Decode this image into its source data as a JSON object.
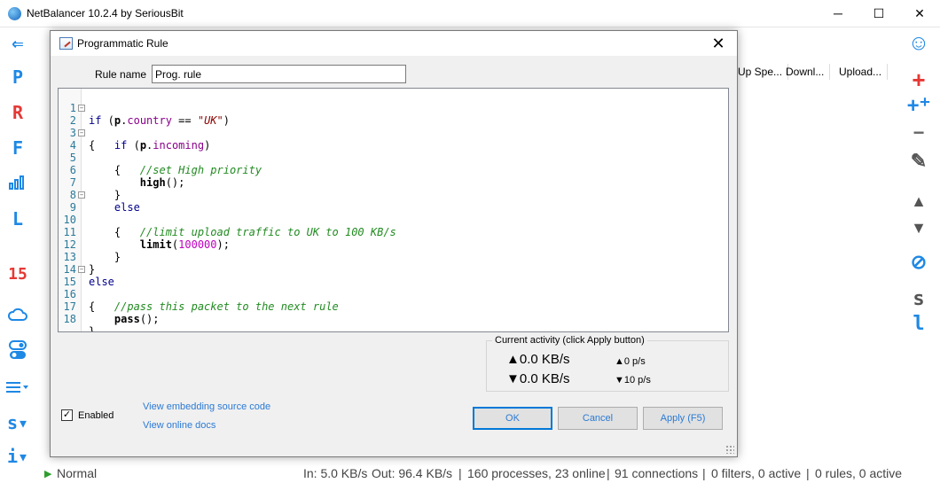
{
  "window": {
    "title": "NetBalancer 10.2.4 by SeriousBit",
    "min": "─",
    "max": "☐",
    "close": "✕"
  },
  "leftbar": {
    "back_icon": "⇐",
    "items": [
      "P",
      "R",
      "F",
      "L",
      "15"
    ],
    "icons": [
      "bar-chart-icon",
      "cloud-icon",
      "toggle-icon",
      "menu-icon",
      "s-menu-icon",
      "info-icon"
    ],
    "s_label": "s▾",
    "i_label": "i▾",
    "colors": {
      "blue": "#1e88e5",
      "red": "#e53935"
    }
  },
  "rightbar": {
    "smile": "☺",
    "add": "+",
    "add_plus": "+⁺",
    "minus": "−",
    "pencil": "✎",
    "up": "▲",
    "down": "▼",
    "block": "⊘",
    "s": "s",
    "l": "l"
  },
  "columns": [
    "Up Spe...",
    "Downl...",
    "Upload..."
  ],
  "dialog": {
    "title": "Programmatic Rule",
    "close": "✕",
    "rule_name_label": "Rule name",
    "rule_name_value": "Prog. rule",
    "code": [
      {
        "n": "1"
      },
      {
        "n": "2"
      },
      {
        "n": "3"
      },
      {
        "n": "4"
      },
      {
        "n": "5"
      },
      {
        "n": "6"
      },
      {
        "n": "7"
      },
      {
        "n": "8"
      },
      {
        "n": "9"
      },
      {
        "n": "10"
      },
      {
        "n": "11"
      },
      {
        "n": "12"
      },
      {
        "n": "13"
      },
      {
        "n": "14"
      },
      {
        "n": "15"
      },
      {
        "n": "16"
      },
      {
        "n": "17"
      },
      {
        "n": "18"
      }
    ],
    "activity_title": "Current activity (click Apply button)",
    "in_rate": "▲0.0 KB/s",
    "out_rate": "▼0.0 KB/s",
    "in_pkts": "▲0 p/s",
    "out_pkts": "▼10 p/s",
    "enabled_label": "Enabled",
    "link_embed": "View embedding source code",
    "link_docs": "View online docs",
    "ok": "OK",
    "cancel": "Cancel",
    "apply": "Apply (F5)"
  },
  "status": {
    "mode": "Normal",
    "in": "In: 5.0 KB/s",
    "out": "Out: 96.4 KB/s",
    "processes": "160 processes, 23 online",
    "connections": "91 connections",
    "filters": "0 filters, 0 active",
    "rules": "0 rules, 0 active"
  }
}
